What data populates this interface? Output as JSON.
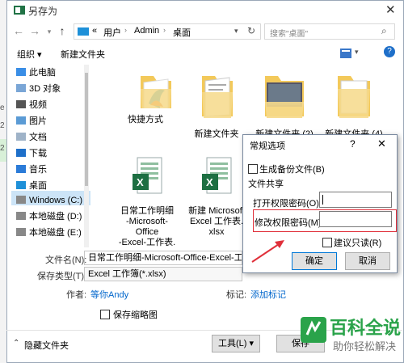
{
  "window_title": "另存为",
  "address": {
    "crumbs": [
      "«",
      "用户",
      "Admin",
      "桌面"
    ],
    "search_placeholder": "搜索\"桌面\""
  },
  "toolbar": {
    "organize": "组织",
    "new_folder": "新建文件夹"
  },
  "sidebar": {
    "items": [
      {
        "label": "此电脑",
        "icon": "computer-icon"
      },
      {
        "label": "3D 对象",
        "icon": "cube-icon"
      },
      {
        "label": "视频",
        "icon": "video-icon"
      },
      {
        "label": "图片",
        "icon": "picture-icon"
      },
      {
        "label": "文档",
        "icon": "document-icon"
      },
      {
        "label": "下载",
        "icon": "download-icon"
      },
      {
        "label": "音乐",
        "icon": "music-icon"
      },
      {
        "label": "桌面",
        "icon": "desktop-icon"
      },
      {
        "label": "Windows (C:)",
        "icon": "drive-icon"
      },
      {
        "label": "本地磁盘 (D:)",
        "icon": "drive-icon"
      },
      {
        "label": "本地磁盘 (E:)",
        "icon": "drive-icon"
      }
    ]
  },
  "left_edge": {
    "chars": [
      "e",
      "2",
      "2"
    ]
  },
  "files": [
    {
      "name": "快捷方式",
      "kind": "folder"
    },
    {
      "name": "新建文件夹",
      "kind": "folder"
    },
    {
      "name": "新建文件夹 (2)",
      "kind": "folder-photo"
    },
    {
      "name": "新建文件夹 (4)",
      "kind": "folder"
    },
    {
      "name": "日常工作明细\n-Microsoft-Office\n-Excel-工作表.",
      "kind": "excel"
    },
    {
      "name": "新建 Microsoft\nExcel 工作表.\nxlsx",
      "kind": "excel"
    }
  ],
  "bottom": {
    "filename_label": "文件名(N):",
    "filename_value": "日常工作明细-Microsoft-Office-Excel-工作表",
    "savetype_label": "保存类型(T):",
    "savetype_value": "Excel 工作簿(*.xlsx)",
    "author_label": "作者:",
    "author_value": "等你Andy",
    "tags_label": "标记:",
    "tags_value": "添加标记",
    "thumbnail_label": "保存缩略图",
    "hide_folders": "隐藏文件夹",
    "tools_button": "工具(L)",
    "save_button": "保存"
  },
  "general_options": {
    "title": "常规选项",
    "help": "?",
    "backup": "生成备份文件(B)",
    "sharing": "文件共享",
    "open_pwd_label": "打开权限密码(O):",
    "modify_pwd_label": "修改权限密码(M):",
    "readonly": "建议只读(R)",
    "ok": "确定",
    "cancel": "取消"
  },
  "watermark": {
    "title": "百科全说",
    "subtitle": "助你轻松解决"
  },
  "colors": {
    "accent": "#0078d7",
    "link": "#0066cc",
    "annotation": "#e0303a",
    "watermark_green": "#2aa34a"
  }
}
